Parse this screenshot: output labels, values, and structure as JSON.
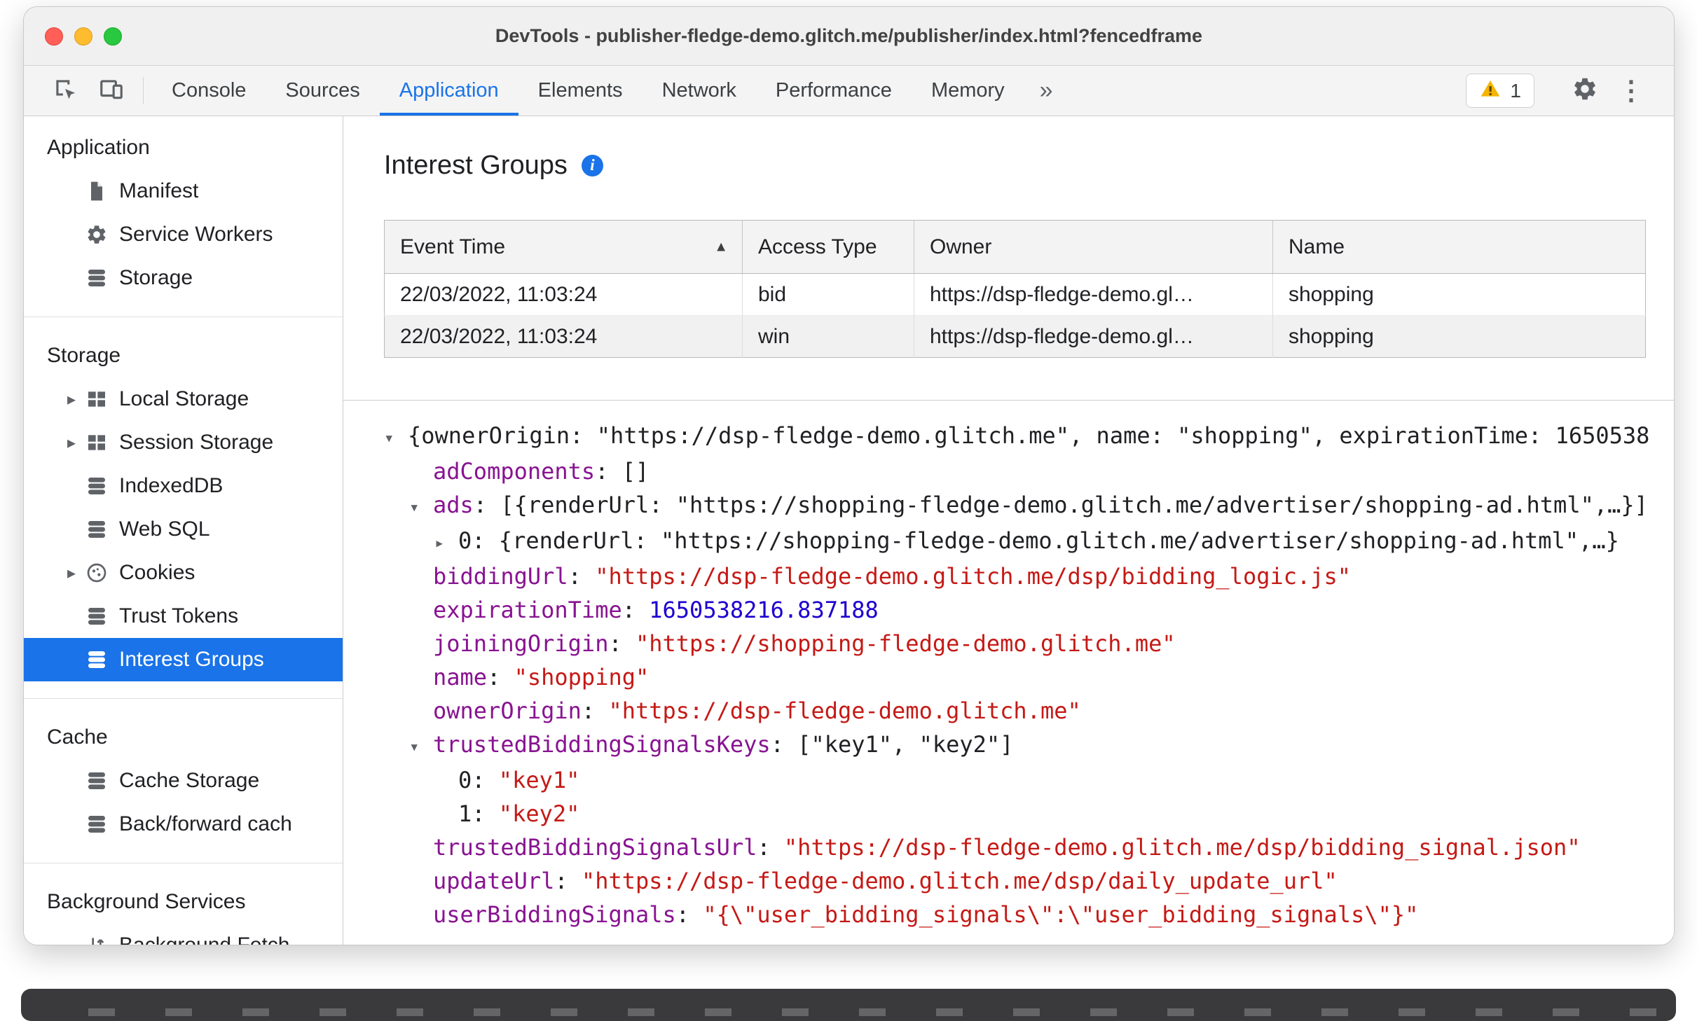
{
  "colors": {
    "accent": "#1a73e8",
    "json_key": "#881391",
    "json_string": "#c41a16",
    "json_number": "#1c00cf",
    "warning_yellow": "#f4b400"
  },
  "icons": {
    "info_glyph": "i",
    "kebab_glyph": "⋮",
    "expander_glyph": "▸",
    "tree_expanded_glyph": "▾",
    "tree_collapsed_glyph": "▸"
  },
  "window": {
    "title": "DevTools - publisher-fledge-demo.glitch.me/publisher/index.html?fencedframe"
  },
  "toolbar": {
    "tabs": [
      {
        "label": "Console"
      },
      {
        "label": "Sources"
      },
      {
        "label": "Application",
        "active": true
      },
      {
        "label": "Elements"
      },
      {
        "label": "Network"
      },
      {
        "label": "Performance"
      },
      {
        "label": "Memory"
      }
    ],
    "more_tabs_symbol": "»",
    "warning_count": "1"
  },
  "sidebar": {
    "sections": [
      {
        "header": "Application",
        "items": [
          {
            "label": "Manifest",
            "icon": "manifest-file-icon"
          },
          {
            "label": "Service Workers",
            "icon": "service-workers-gear-icon"
          },
          {
            "label": "Storage",
            "icon": "database-stack-icon"
          }
        ]
      },
      {
        "header": "Storage",
        "items": [
          {
            "label": "Local Storage",
            "icon": "table-grid-icon",
            "expandable": true
          },
          {
            "label": "Session Storage",
            "icon": "table-grid-icon",
            "expandable": true
          },
          {
            "label": "IndexedDB",
            "icon": "database-stack-icon"
          },
          {
            "label": "Web SQL",
            "icon": "database-stack-icon"
          },
          {
            "label": "Cookies",
            "icon": "cookie-icon",
            "expandable": true
          },
          {
            "label": "Trust Tokens",
            "icon": "database-stack-icon"
          },
          {
            "label": "Interest Groups",
            "icon": "database-stack-icon",
            "selected": true
          }
        ]
      },
      {
        "header": "Cache",
        "items": [
          {
            "label": "Cache Storage",
            "icon": "database-stack-icon"
          },
          {
            "label": "Back/forward cach",
            "icon": "database-stack-icon"
          }
        ]
      },
      {
        "header": "Background Services",
        "items": [
          {
            "label": "Background Fetch",
            "icon": "updown-arrows-icon"
          }
        ]
      }
    ]
  },
  "main": {
    "title": "Interest Groups",
    "table": {
      "columns": [
        "Event Time",
        "Access Type",
        "Owner",
        "Name"
      ],
      "sorted_column": "Event Time",
      "sort_ascending_glyph": "▲",
      "rows": [
        [
          "22/03/2022, 11:03:24",
          "bid",
          "https://dsp-fledge-demo.gl…",
          "shopping"
        ],
        [
          "22/03/2022, 11:03:24",
          "win",
          "https://dsp-fledge-demo.gl…",
          "shopping"
        ]
      ]
    },
    "json_tree": {
      "lines": [
        {
          "indent": 0,
          "arrow": "down",
          "segments": [
            {
              "t": "plain",
              "v": "{ownerOrigin: \"https://dsp-fledge-demo.glitch.me\", name: \"shopping\", expirationTime: 1650538"
            }
          ]
        },
        {
          "indent": 1,
          "arrow": null,
          "segments": [
            {
              "t": "key",
              "v": "adComponents"
            },
            {
              "t": "plain",
              "v": ": []"
            }
          ]
        },
        {
          "indent": 1,
          "arrow": "down",
          "segments": [
            {
              "t": "key",
              "v": "ads"
            },
            {
              "t": "plain",
              "v": ": [{renderUrl: \"https://shopping-fledge-demo.glitch.me/advertiser/shopping-ad.html\",…}]"
            }
          ]
        },
        {
          "indent": 2,
          "arrow": "right",
          "segments": [
            {
              "t": "plain",
              "v": "0: {renderUrl: \"https://shopping-fledge-demo.glitch.me/advertiser/shopping-ad.html\",…}"
            }
          ]
        },
        {
          "indent": 1,
          "arrow": null,
          "segments": [
            {
              "t": "key",
              "v": "biddingUrl"
            },
            {
              "t": "plain",
              "v": ": "
            },
            {
              "t": "string",
              "v": "\"https://dsp-fledge-demo.glitch.me/dsp/bidding_logic.js\""
            }
          ]
        },
        {
          "indent": 1,
          "arrow": null,
          "segments": [
            {
              "t": "key",
              "v": "expirationTime"
            },
            {
              "t": "plain",
              "v": ": "
            },
            {
              "t": "number",
              "v": "1650538216.837188"
            }
          ]
        },
        {
          "indent": 1,
          "arrow": null,
          "segments": [
            {
              "t": "key",
              "v": "joiningOrigin"
            },
            {
              "t": "plain",
              "v": ": "
            },
            {
              "t": "string",
              "v": "\"https://shopping-fledge-demo.glitch.me\""
            }
          ]
        },
        {
          "indent": 1,
          "arrow": null,
          "segments": [
            {
              "t": "key",
              "v": "name"
            },
            {
              "t": "plain",
              "v": ": "
            },
            {
              "t": "string",
              "v": "\"shopping\""
            }
          ]
        },
        {
          "indent": 1,
          "arrow": null,
          "segments": [
            {
              "t": "key",
              "v": "ownerOrigin"
            },
            {
              "t": "plain",
              "v": ": "
            },
            {
              "t": "string",
              "v": "\"https://dsp-fledge-demo.glitch.me\""
            }
          ]
        },
        {
          "indent": 1,
          "arrow": "down",
          "segments": [
            {
              "t": "key",
              "v": "trustedBiddingSignalsKeys"
            },
            {
              "t": "plain",
              "v": ": [\"key1\", \"key2\"]"
            }
          ]
        },
        {
          "indent": 2,
          "arrow": null,
          "segments": [
            {
              "t": "plain",
              "v": "0: "
            },
            {
              "t": "string",
              "v": "\"key1\""
            }
          ]
        },
        {
          "indent": 2,
          "arrow": null,
          "segments": [
            {
              "t": "plain",
              "v": "1: "
            },
            {
              "t": "string",
              "v": "\"key2\""
            }
          ]
        },
        {
          "indent": 1,
          "arrow": null,
          "segments": [
            {
              "t": "key",
              "v": "trustedBiddingSignalsUrl"
            },
            {
              "t": "plain",
              "v": ": "
            },
            {
              "t": "string",
              "v": "\"https://dsp-fledge-demo.glitch.me/dsp/bidding_signal.json\""
            }
          ]
        },
        {
          "indent": 1,
          "arrow": null,
          "segments": [
            {
              "t": "key",
              "v": "updateUrl"
            },
            {
              "t": "plain",
              "v": ": "
            },
            {
              "t": "string",
              "v": "\"https://dsp-fledge-demo.glitch.me/dsp/daily_update_url\""
            }
          ]
        },
        {
          "indent": 1,
          "arrow": null,
          "segments": [
            {
              "t": "key",
              "v": "userBiddingSignals"
            },
            {
              "t": "plain",
              "v": ": "
            },
            {
              "t": "string",
              "v": "\"{\\\"user_bidding_signals\\\":\\\"user_bidding_signals\\\"}\""
            }
          ]
        }
      ]
    }
  }
}
